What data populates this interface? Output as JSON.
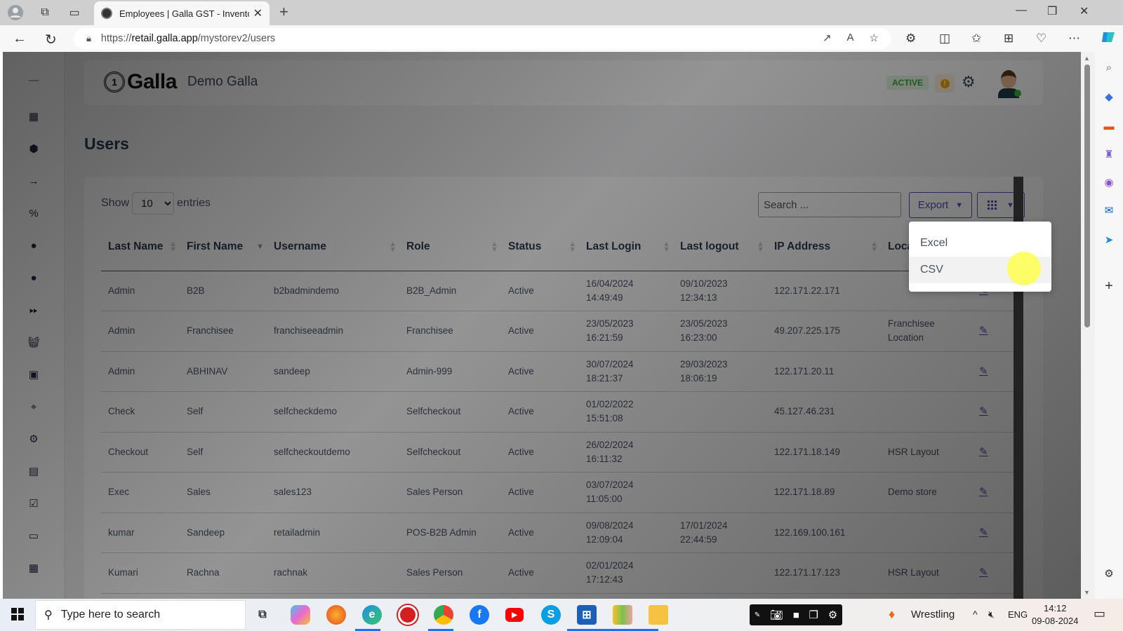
{
  "browser": {
    "tab_title": "Employees | Galla GST - Inventory",
    "url_prefix": "https://",
    "url_host": "retail.galla.app",
    "url_path": "/mystorev2/users",
    "new_tab": "+",
    "window_controls": [
      "—",
      "❐",
      "✕"
    ]
  },
  "header": {
    "brand": "Galla",
    "store_name": "Demo Galla",
    "status_badge": "ACTIVE",
    "alert_icon": "!",
    "accent_color": "#4d4fb8",
    "status_color": "#3aa63a",
    "warning_color": "#f0a30a"
  },
  "sidebar": {
    "items": [
      {
        "icon": "collapse-icon"
      },
      {
        "icon": "dashboard-icon"
      },
      {
        "icon": "products-box-icon"
      },
      {
        "icon": "arrow-right-icon"
      },
      {
        "icon": "coupon-icon"
      },
      {
        "icon": "customer-icon"
      },
      {
        "icon": "user-icon"
      },
      {
        "icon": "fast-forward-icon"
      },
      {
        "icon": "basket-icon"
      },
      {
        "icon": "contacts-icon"
      },
      {
        "icon": "location-icon"
      },
      {
        "icon": "settings-icon"
      },
      {
        "icon": "report-icon"
      },
      {
        "icon": "checkbox-icon"
      },
      {
        "icon": "cash-icon"
      },
      {
        "icon": "calendar-icon"
      }
    ]
  },
  "page": {
    "title": "Users",
    "show_label": "Show",
    "entries_label": "entries",
    "page_size": "10",
    "search_placeholder": "Search ...",
    "export_label": "Export",
    "export_menu": [
      {
        "label": "Excel"
      },
      {
        "label": "CSV"
      }
    ]
  },
  "table": {
    "columns": [
      "Last Name",
      "First Name",
      "Username",
      "Role",
      "Status",
      "Last Login",
      "Last logout",
      "IP Address",
      "Location",
      ""
    ],
    "rows": [
      {
        "last": "Admin",
        "first": "B2B",
        "username": "b2badmindemo",
        "role": "B2B_Admin",
        "status": "Active",
        "login_date": "16/04/2024",
        "login_time": "14:49:49",
        "logout_date": "09/10/2023",
        "logout_time": "12:34:13",
        "ip": "122.171.22.171",
        "location": ""
      },
      {
        "last": "Admin",
        "first": "Franchisee",
        "username": "franchiseeadmin",
        "role": "Franchisee",
        "status": "Active",
        "login_date": "23/05/2023",
        "login_time": "16:21:59",
        "logout_date": "23/05/2023",
        "logout_time": "16:23:00",
        "ip": "49.207.225.175",
        "location": "Franchisee Location"
      },
      {
        "last": "Admin",
        "first": "ABHINAV",
        "username": "sandeep",
        "role": "Admin-999",
        "status": "Active",
        "login_date": "30/07/2024",
        "login_time": "18:21:37",
        "logout_date": "29/03/2023",
        "logout_time": "18:06:19",
        "ip": "122.171.20.11",
        "location": ""
      },
      {
        "last": "Check",
        "first": "Self",
        "username": "selfcheckdemo",
        "role": "Selfcheckout",
        "status": "Active",
        "login_date": "01/02/2022",
        "login_time": "15:51:08",
        "logout_date": "",
        "logout_time": "",
        "ip": "45.127.46.231",
        "location": ""
      },
      {
        "last": "Checkout",
        "first": "Self",
        "username": "selfcheckoutdemo",
        "role": "Selfcheckout",
        "status": "Active",
        "login_date": "26/02/2024",
        "login_time": "16:11:32",
        "logout_date": "",
        "logout_time": "",
        "ip": "122.171.18.149",
        "location": "HSR Layout"
      },
      {
        "last": "Exec",
        "first": "Sales",
        "username": "sales123",
        "role": "Sales Person",
        "status": "Active",
        "login_date": "03/07/2024",
        "login_time": "11:05:00",
        "logout_date": "",
        "logout_time": "",
        "ip": "122.171.18.89",
        "location": "Demo store"
      },
      {
        "last": "kumar",
        "first": "Sandeep",
        "username": "retailadmin",
        "role": "POS-B2B Admin",
        "status": "Active",
        "login_date": "09/08/2024",
        "login_time": "12:09:04",
        "logout_date": "17/01/2024",
        "logout_time": "22:44:59",
        "ip": "122.169.100.161",
        "location": ""
      },
      {
        "last": "Kumari",
        "first": "Rachna",
        "username": "rachnak",
        "role": "Sales Person",
        "status": "Active",
        "login_date": "02/01/2024",
        "login_time": "17:12:43",
        "logout_date": "",
        "logout_time": "",
        "ip": "122.171.17.123",
        "location": "HSR Layout"
      }
    ]
  },
  "taskbar": {
    "search_placeholder": "Type here to search",
    "weather_label": "Wrestling",
    "language": "ENG",
    "time": "14:12",
    "date": "09-08-2024"
  }
}
